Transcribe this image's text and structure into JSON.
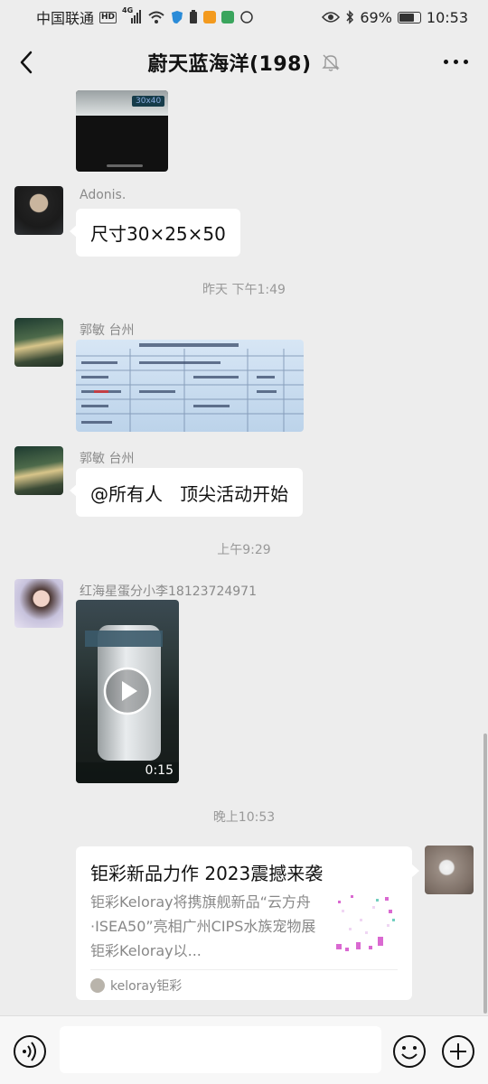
{
  "status_bar": {
    "carrier": "中国联通",
    "network": "4G",
    "hd_badge": "HD",
    "battery_percent": "69%",
    "battery_level": 0.69,
    "time": "10:53"
  },
  "header": {
    "title": "蔚天蓝海洋(198)",
    "back_icon": "chevron-left-icon",
    "mute_icon": "bell-off-icon",
    "more_icon": "more-dots-icon"
  },
  "messages": [
    {
      "type": "image",
      "sender": "",
      "image_label": "30x40"
    },
    {
      "type": "text",
      "sender": "Adonis.",
      "text": "尺寸30×25×50"
    },
    {
      "type": "timestamp",
      "text": "昨天 下午1:49"
    },
    {
      "type": "image",
      "sender": "郭敏  台州"
    },
    {
      "type": "text",
      "sender": "郭敏  台州",
      "text": "@所有人   顶尖活动开始"
    },
    {
      "type": "timestamp",
      "text": "上午9:29"
    },
    {
      "type": "video",
      "sender": "红海星蛋分小李18123724971",
      "duration": "0:15"
    },
    {
      "type": "timestamp",
      "text": "晚上10:53"
    },
    {
      "type": "link_card",
      "title": "钜彩新品力作 2023震撼来袭",
      "description": "钜彩Keloray将携旗舰新品“云方舟·ISEA50”亮相广州CIPS水族宠物展钜彩Keloray以...",
      "source": "keloray钜彩"
    }
  ],
  "input_bar": {
    "placeholder": "",
    "voice_icon": "voice-icon",
    "emoji_icon": "emoji-icon",
    "plus_icon": "plus-icon"
  },
  "colors": {
    "background": "#ededed",
    "bubble": "#ffffff",
    "timestamp": "#999999"
  }
}
